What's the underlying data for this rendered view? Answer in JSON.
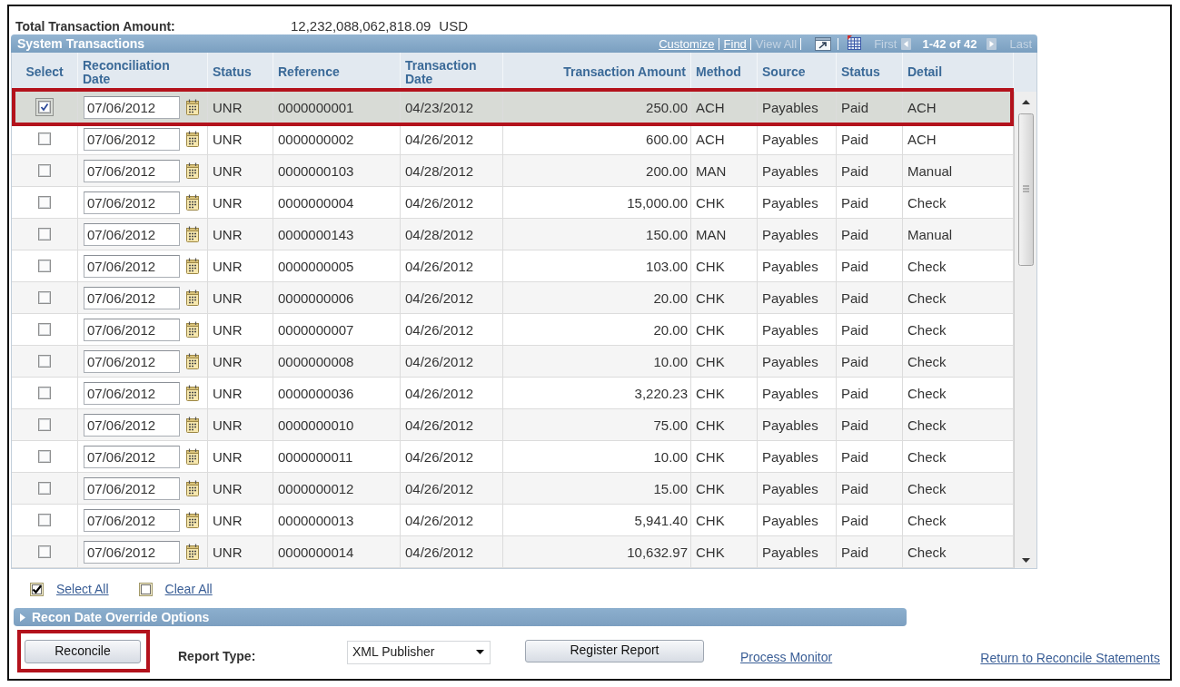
{
  "summary": {
    "label": "Total Transaction Amount:",
    "amount": "12,232,088,062,818.09",
    "currency": "USD"
  },
  "grid": {
    "title": "System Transactions",
    "links": [
      {
        "label": "Customize",
        "disabled": false
      },
      {
        "label": "Find",
        "disabled": false
      },
      {
        "label": "View All",
        "disabled": true
      }
    ],
    "pager": {
      "first": {
        "label": "First",
        "disabled": true
      },
      "range": "1-42 of 42",
      "last": {
        "label": "Last",
        "disabled": true
      }
    },
    "columns": [
      "Select",
      "Reconciliation Date",
      "Status",
      "Reference",
      "Transaction Date",
      "Transaction Amount",
      "Method",
      "Source",
      "Status",
      "Detail"
    ],
    "rows": [
      {
        "selected": true,
        "outlined": true,
        "recon_date": "07/06/2012",
        "status": "UNR",
        "reference": "0000000001",
        "transaction_date": "04/23/2012",
        "amount": "250.00",
        "method": "ACH",
        "source": "Payables",
        "payment_status": "Paid",
        "detail": "ACH"
      },
      {
        "selected": false,
        "outlined": false,
        "recon_date": "07/06/2012",
        "status": "UNR",
        "reference": "0000000002",
        "transaction_date": "04/26/2012",
        "amount": "600.00",
        "method": "ACH",
        "source": "Payables",
        "payment_status": "Paid",
        "detail": "ACH"
      },
      {
        "selected": false,
        "outlined": false,
        "recon_date": "07/06/2012",
        "status": "UNR",
        "reference": "0000000103",
        "transaction_date": "04/28/2012",
        "amount": "200.00",
        "method": "MAN",
        "source": "Payables",
        "payment_status": "Paid",
        "detail": "Manual"
      },
      {
        "selected": false,
        "outlined": false,
        "recon_date": "07/06/2012",
        "status": "UNR",
        "reference": "0000000004",
        "transaction_date": "04/26/2012",
        "amount": "15,000.00",
        "method": "CHK",
        "source": "Payables",
        "payment_status": "Paid",
        "detail": "Check"
      },
      {
        "selected": false,
        "outlined": false,
        "recon_date": "07/06/2012",
        "status": "UNR",
        "reference": "0000000143",
        "transaction_date": "04/28/2012",
        "amount": "150.00",
        "method": "MAN",
        "source": "Payables",
        "payment_status": "Paid",
        "detail": "Manual"
      },
      {
        "selected": false,
        "outlined": false,
        "recon_date": "07/06/2012",
        "status": "UNR",
        "reference": "0000000005",
        "transaction_date": "04/26/2012",
        "amount": "103.00",
        "method": "CHK",
        "source": "Payables",
        "payment_status": "Paid",
        "detail": "Check"
      },
      {
        "selected": false,
        "outlined": false,
        "recon_date": "07/06/2012",
        "status": "UNR",
        "reference": "0000000006",
        "transaction_date": "04/26/2012",
        "amount": "20.00",
        "method": "CHK",
        "source": "Payables",
        "payment_status": "Paid",
        "detail": "Check"
      },
      {
        "selected": false,
        "outlined": false,
        "recon_date": "07/06/2012",
        "status": "UNR",
        "reference": "0000000007",
        "transaction_date": "04/26/2012",
        "amount": "20.00",
        "method": "CHK",
        "source": "Payables",
        "payment_status": "Paid",
        "detail": "Check"
      },
      {
        "selected": false,
        "outlined": false,
        "recon_date": "07/06/2012",
        "status": "UNR",
        "reference": "0000000008",
        "transaction_date": "04/26/2012",
        "amount": "10.00",
        "method": "CHK",
        "source": "Payables",
        "payment_status": "Paid",
        "detail": "Check"
      },
      {
        "selected": false,
        "outlined": false,
        "recon_date": "07/06/2012",
        "status": "UNR",
        "reference": "0000000036",
        "transaction_date": "04/26/2012",
        "amount": "3,220.23",
        "method": "CHK",
        "source": "Payables",
        "payment_status": "Paid",
        "detail": "Check"
      },
      {
        "selected": false,
        "outlined": false,
        "recon_date": "07/06/2012",
        "status": "UNR",
        "reference": "0000000010",
        "transaction_date": "04/26/2012",
        "amount": "75.00",
        "method": "CHK",
        "source": "Payables",
        "payment_status": "Paid",
        "detail": "Check"
      },
      {
        "selected": false,
        "outlined": false,
        "recon_date": "07/06/2012",
        "status": "UNR",
        "reference": "0000000011",
        "transaction_date": "04/26/2012",
        "amount": "10.00",
        "method": "CHK",
        "source": "Payables",
        "payment_status": "Paid",
        "detail": "Check"
      },
      {
        "selected": false,
        "outlined": false,
        "recon_date": "07/06/2012",
        "status": "UNR",
        "reference": "0000000012",
        "transaction_date": "04/26/2012",
        "amount": "15.00",
        "method": "CHK",
        "source": "Payables",
        "payment_status": "Paid",
        "detail": "Check"
      },
      {
        "selected": false,
        "outlined": false,
        "recon_date": "07/06/2012",
        "status": "UNR",
        "reference": "0000000013",
        "transaction_date": "04/26/2012",
        "amount": "5,941.40",
        "method": "CHK",
        "source": "Payables",
        "payment_status": "Paid",
        "detail": "Check"
      },
      {
        "selected": false,
        "outlined": false,
        "recon_date": "07/06/2012",
        "status": "UNR",
        "reference": "0000000014",
        "transaction_date": "04/26/2012",
        "amount": "10,632.97",
        "method": "CHK",
        "source": "Payables",
        "payment_status": "Paid",
        "detail": "Check"
      }
    ]
  },
  "bulk_actions": [
    {
      "label": "Select All",
      "checked": true
    },
    {
      "label": "Clear All",
      "checked": false
    }
  ],
  "override_section": {
    "title": "Recon Date Override Options",
    "expanded": false
  },
  "footer": {
    "reconcile": {
      "label": "Reconcile",
      "outlined": true
    },
    "report_type": {
      "label": "Report Type:",
      "value": "XML Publisher"
    },
    "register": {
      "label": "Register Report"
    },
    "links": [
      "Process Monitor",
      "Return to Reconcile Statements"
    ]
  }
}
